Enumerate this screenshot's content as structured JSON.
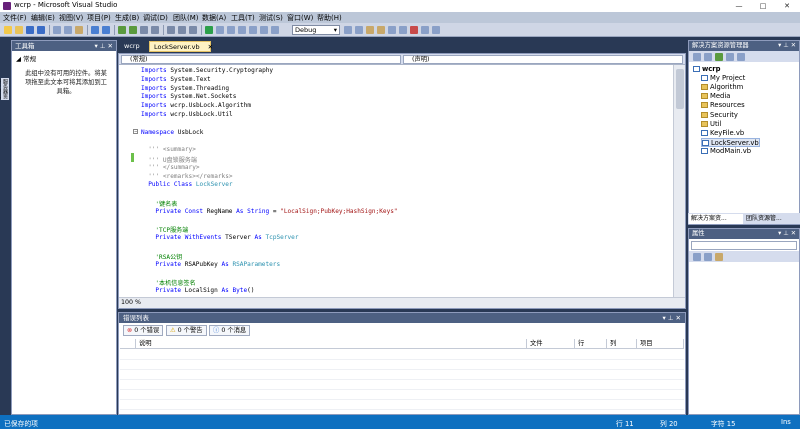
{
  "window": {
    "title": "wcrp - Microsoft Visual Studio",
    "minimize": "—",
    "maximize": "□",
    "close": "✕"
  },
  "menu": [
    "文件(F)",
    "编辑(E)",
    "视图(V)",
    "项目(P)",
    "生成(B)",
    "调试(D)",
    "团队(M)",
    "数据(A)",
    "工具(T)",
    "测试(S)",
    "窗口(W)",
    "帮助(H)"
  ],
  "toolbar": {
    "config": "Debug"
  },
  "leftstrip": {
    "tab": "服务器资源管理器"
  },
  "toolbox": {
    "title": "工具箱",
    "pin": "▾ ⊥ ✕",
    "group": "◢ 常规",
    "empty_text": "此组中没有可用的控件。将某项拖至此文本可将其添加到工具箱。"
  },
  "doc_tabs": {
    "tab1": "wcrp",
    "tab2": "LockServer.vb",
    "close": "✕"
  },
  "editor": {
    "nav_left": "(常规)",
    "nav_right": "(声明)",
    "zoom": "100 %",
    "lines": [
      {
        "t": "Imports System.Security.Cryptography",
        "indent": 0,
        "kind": "import"
      },
      {
        "t": "Imports System.Text",
        "indent": 0,
        "kind": "import"
      },
      {
        "t": "Imports System.Threading",
        "indent": 0,
        "kind": "import"
      },
      {
        "t": "Imports System.Net.Sockets",
        "indent": 0,
        "kind": "import"
      },
      {
        "t": "Imports wcrp.UsbLock.Algorithm",
        "indent": 0,
        "kind": "import"
      },
      {
        "t": "Imports wcrp.UsbLock.Util",
        "indent": 0,
        "kind": "import"
      },
      {
        "t": "",
        "indent": 0,
        "kind": "blank"
      },
      {
        "t": "Namespace UsbLock",
        "indent": 0,
        "kind": "ns"
      },
      {
        "t": "",
        "indent": 0,
        "kind": "blank"
      },
      {
        "t": "''' <summary>",
        "indent": 2,
        "kind": "doc"
      },
      {
        "t": "''' U盘锁服务端",
        "indent": 2,
        "kind": "doc"
      },
      {
        "t": "''' </summary>",
        "indent": 2,
        "kind": "doc"
      },
      {
        "t": "''' <remarks></remarks>",
        "indent": 2,
        "kind": "doc"
      },
      {
        "t": "Public Class LockServer",
        "indent": 2,
        "kind": "class"
      },
      {
        "t": "",
        "indent": 0,
        "kind": "blank"
      },
      {
        "t": "'键名表",
        "indent": 4,
        "kind": "comment"
      },
      {
        "t": "Private Const RegName As String = \"LocalSign;PubKey;HashSign;Keys\"",
        "indent": 4,
        "kind": "const"
      },
      {
        "t": "",
        "indent": 0,
        "kind": "blank"
      },
      {
        "t": "'TCP服务端",
        "indent": 4,
        "kind": "comment"
      },
      {
        "t": "Private WithEvents TServer As TcpServer",
        "indent": 4,
        "kind": "tcp"
      },
      {
        "t": "",
        "indent": 0,
        "kind": "blank"
      },
      {
        "t": "'RSA公钥",
        "indent": 4,
        "kind": "comment"
      },
      {
        "t": "Private RSAPubKey As RSAParameters",
        "indent": 4,
        "kind": "rsa"
      },
      {
        "t": "",
        "indent": 0,
        "kind": "blank"
      },
      {
        "t": "'本机信息签名",
        "indent": 4,
        "kind": "comment"
      },
      {
        "t": "Private LocalSign As Byte()",
        "indent": 4,
        "kind": "byte"
      }
    ]
  },
  "error_list": {
    "title": "错误列表",
    "pin": "▾ ⊥ ✕",
    "errors": "0 个错误",
    "warnings": "0 个警告",
    "messages": "0 个消息",
    "columns": [
      "说明",
      "文件",
      "行",
      "列",
      "项目"
    ]
  },
  "solution_explorer": {
    "title": "解决方案资源管理器",
    "pin": "▾ ⊥ ✕",
    "items": [
      {
        "label": "wcrp",
        "level": 0,
        "type": "project",
        "bold": true
      },
      {
        "label": "My Project",
        "level": 1,
        "type": "special"
      },
      {
        "label": "Algorithm",
        "level": 1,
        "type": "folder"
      },
      {
        "label": "Media",
        "level": 1,
        "type": "folder"
      },
      {
        "label": "Resources",
        "level": 1,
        "type": "folder"
      },
      {
        "label": "Security",
        "level": 1,
        "type": "folder"
      },
      {
        "label": "Util",
        "level": 1,
        "type": "folder"
      },
      {
        "label": "KeyFile.vb",
        "level": 1,
        "type": "vb"
      },
      {
        "label": "LockServer.vb",
        "level": 1,
        "type": "vb",
        "selected": true
      },
      {
        "label": "ModMain.vb",
        "level": 1,
        "type": "vb"
      }
    ],
    "tabs": [
      "解决方案资...",
      "团队资源管..."
    ]
  },
  "properties": {
    "title": "属性",
    "pin": "▾ ⊥ ✕"
  },
  "status": {
    "ready": "已保存的项",
    "line": "行 11",
    "col": "列 20",
    "ch": "字符 15",
    "mode": "Ins"
  },
  "colors": {
    "chrome": "#293955",
    "panel_header": "#4d6082",
    "status": "#0e70c0",
    "keyword": "#0000ff",
    "type": "#2b91af",
    "comment": "#008000",
    "string": "#a31515"
  }
}
